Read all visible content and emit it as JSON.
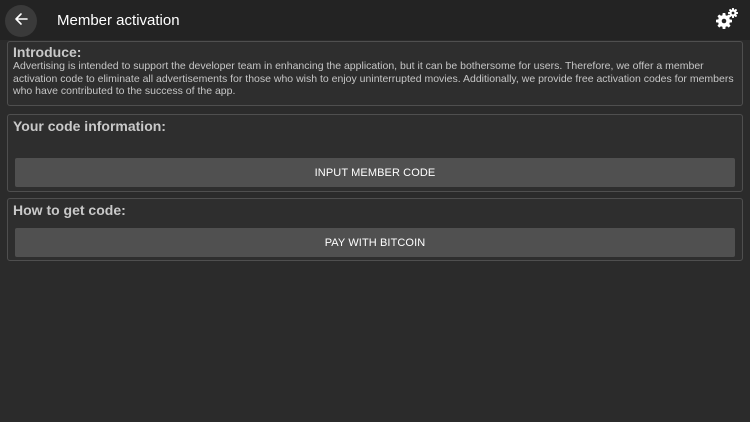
{
  "header": {
    "title": "Member activation",
    "back_icon": "arrow-left-icon",
    "settings_icon": "gears-icon"
  },
  "introduce": {
    "heading": "Introduce:",
    "text": "Advertising is intended to support the developer team in enhancing the application, but it can be bothersome for users. Therefore, we offer a member activation code to eliminate all advertisements for those who wish to enjoy uninterrupted movies. Additionally, we provide free activation codes for members who have contributed to the success of the app."
  },
  "code_info": {
    "heading": "Your code information:",
    "button_label": "INPUT MEMBER CODE"
  },
  "get_code": {
    "heading": "How to get code:",
    "button_label": "PAY WITH BITCOIN"
  },
  "colors": {
    "background": "#2b2b2b",
    "toolbar": "#232323",
    "button": "#505050",
    "panel_border": "#4f4f4f"
  }
}
